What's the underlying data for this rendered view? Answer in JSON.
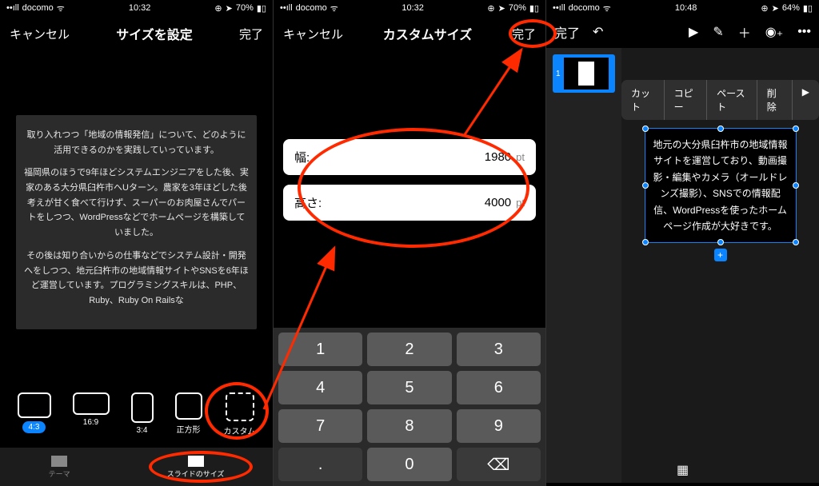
{
  "screen1": {
    "status": {
      "carrier": "docomo",
      "time": "10:32",
      "battery": "70%"
    },
    "nav": {
      "cancel": "キャンセル",
      "title": "サイズを設定",
      "done": "完了"
    },
    "body": {
      "p1": "取り入れつつ「地域の情報発信」について、どのように活用できるのかを実践していっています。",
      "p2": "福岡県のほうで9年ほどシステムエンジニアをした後、実家のある大分県臼杵市へUターン。農家を3年ほどした後考えが甘く食べて行けず、スーパーのお肉屋さんでパートをしつつ、WordPressなどでホームページを構築していました。",
      "p3": "その後は知り合いからの仕事などでシステム設計・開発へをしつつ、地元臼杵市の地域情報サイトやSNSを6年ほど運営しています。プログラミングスキルは、PHP、Ruby、Ruby On Railsな"
    },
    "ratios": {
      "r43": "4:3",
      "r169": "16:9",
      "r34": "3:4",
      "square": "正方形",
      "custom": "カスタム"
    },
    "tabs": {
      "theme": "テーマ",
      "size": "スライドのサイズ"
    }
  },
  "screen2": {
    "status": {
      "carrier": "docomo",
      "time": "10:32",
      "battery": "70%"
    },
    "nav": {
      "cancel": "キャンセル",
      "title": "カスタムサイズ",
      "done": "完了"
    },
    "width": {
      "label": "幅:",
      "value": "1980",
      "unit": "pt"
    },
    "height": {
      "label": "高さ:",
      "value": "4000",
      "unit": "pt"
    },
    "keys": [
      "1",
      "2",
      "3",
      "4",
      "5",
      "6",
      "7",
      "8",
      "9",
      ".",
      "0",
      "⌫"
    ]
  },
  "screen3": {
    "status": {
      "carrier": "docomo",
      "time": "10:48",
      "battery": "64%"
    },
    "toolbar": {
      "done": "完了"
    },
    "thumb_num": "1",
    "ctx": {
      "cut": "カット",
      "copy": "コピー",
      "paste": "ペースト",
      "delete": "削除",
      "more": "▶"
    },
    "textbox": "地元の大分県臼杵市の地域情報サイトを運営しており、動画撮影・編集やカメラ（オールドレンズ撮影）、SNSでの情報配信、WordPressを使ったホームページ作成が大好きです。"
  }
}
